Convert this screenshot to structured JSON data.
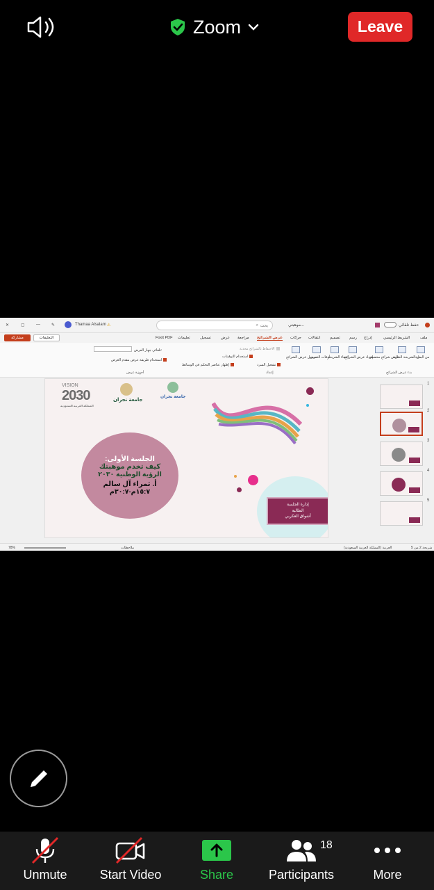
{
  "topbar": {
    "title": "Zoom",
    "leave_label": "Leave",
    "icons": [
      "speaker-icon",
      "shield-check-icon",
      "chevron-down-icon"
    ]
  },
  "powerpoint": {
    "file_name": "موهبتي...",
    "save_label": "حفظ تلقائي",
    "search_placeholder": "بحث",
    "user_name": "Thamaa Alsalam",
    "tabs": [
      "ملف",
      "الشريط الرئيسي",
      "إدراج",
      "رسم",
      "تصميم",
      "انتقالات",
      "حركات",
      "عرض الشرائح",
      "مراجعة",
      "عرض",
      "تسجيل",
      "تعليمات",
      "Foxit PDF"
    ],
    "active_tab": "عرض الشرائح",
    "share_label": "مشاركة",
    "comments_label": "التعليقات",
    "ribbon": {
      "group1_label": "بدء عرض الشرائح",
      "group2_label": "إعداد",
      "group3_label": "أجهزة عرض",
      "buttons": [
        "من البداية",
        "من الشريحة الحالية",
        "عرض شرائح مخصص",
        "إعداد عرض الشرائح",
        "إخفاء الشريحة",
        "أوقات التمرين",
        "تسجيل عرض الشرائح"
      ],
      "checkbox_play_narrations": "تشغيل السرد",
      "checkbox_use_timings": "استخدام التوقيتات",
      "checkbox_show_media": "إظهار عناصر التحكم في الوسائط",
      "checkbox_presenter_view": "استخدام طريقة عرض مقدم العرض",
      "monitor_label": "جهاز العرض:",
      "monitor_value": "تلقائي",
      "keep_updated": "الاحتفاظ بالشرائح محدثة"
    },
    "slide": {
      "vision_label": "VISION",
      "vision_year": "2030",
      "vision_sub": "المملكة العربية السعودية",
      "najran_logo": "جامعة نجران",
      "najran_logo2": "جامعة نجران",
      "line1": "الجلسة الأولى:",
      "line2": "كيف تخدم موهبتك",
      "line3": "الرؤية الوطنية ٢٠٣٠",
      "line4": "أ. ثمراء آل سالم",
      "line5": "١٥:٧م-٣٠:٧م",
      "mgmt_line1": "إدارة الجلسة",
      "mgmt_line2": "الطالبة",
      "mgmt_line3": "أشواق العكربي"
    },
    "thumbnails": [
      "1",
      "2",
      "3",
      "4",
      "5"
    ],
    "selected_thumbnail": 2,
    "status": {
      "slide_info": "شريحة 2 من 5",
      "language": "العربية (المملكة العربية السعودية)",
      "notes": "ملاحظات",
      "zoom": "78%"
    }
  },
  "bottombar": {
    "unmute_label": "Unmute",
    "start_video_label": "Start Video",
    "share_label": "Share",
    "participants_label": "Participants",
    "participants_count": "18",
    "more_label": "More"
  },
  "colors": {
    "leave": "#e02828",
    "share_green": "#2bc64a",
    "slide_circle": "#c3899f",
    "slide_box": "#8a2a55"
  }
}
